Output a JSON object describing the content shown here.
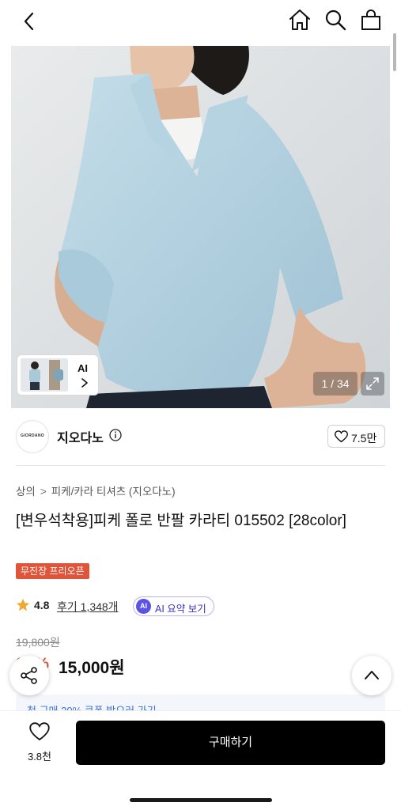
{
  "header": {
    "back_icon": "chevron-left-icon",
    "home_icon": "home-icon",
    "search_icon": "search-icon",
    "bag_icon": "shopping-bag-icon"
  },
  "gallery": {
    "thumbnail_ai_label": "AI",
    "counter": "1 / 34",
    "expand_icon": "expand-icon"
  },
  "brand": {
    "logo_text": "GIORDANO",
    "name": "지오다노",
    "like_count": "7.5만"
  },
  "product": {
    "breadcrumb": [
      "상의",
      "피케/카라 티셔츠 (지오다노)"
    ],
    "title": "[변우석착용]피케 폴로 반팔 카라티 015502 [28color]",
    "promo_badge": "무진장 프리오픈",
    "rating": "4.8",
    "reviews": "후기 1,348개",
    "ai_badge": "AI",
    "ai_summary": "AI 요약 보기",
    "original_price": "19,800원",
    "discount": "24%",
    "price": "15,000원",
    "coupon_peek": "첫 구매 20% 쿠폰 받으러 가기"
  },
  "actions": {
    "share_icon": "share-icon",
    "top_icon": "chevron-up-icon",
    "wishlist_count": "3.8천",
    "buy_label": "구매하기"
  },
  "colors": {
    "accent": "#e0553a",
    "ai_purple": "#5b53e6",
    "star": "#f0a830",
    "buy_bg": "#000000"
  }
}
